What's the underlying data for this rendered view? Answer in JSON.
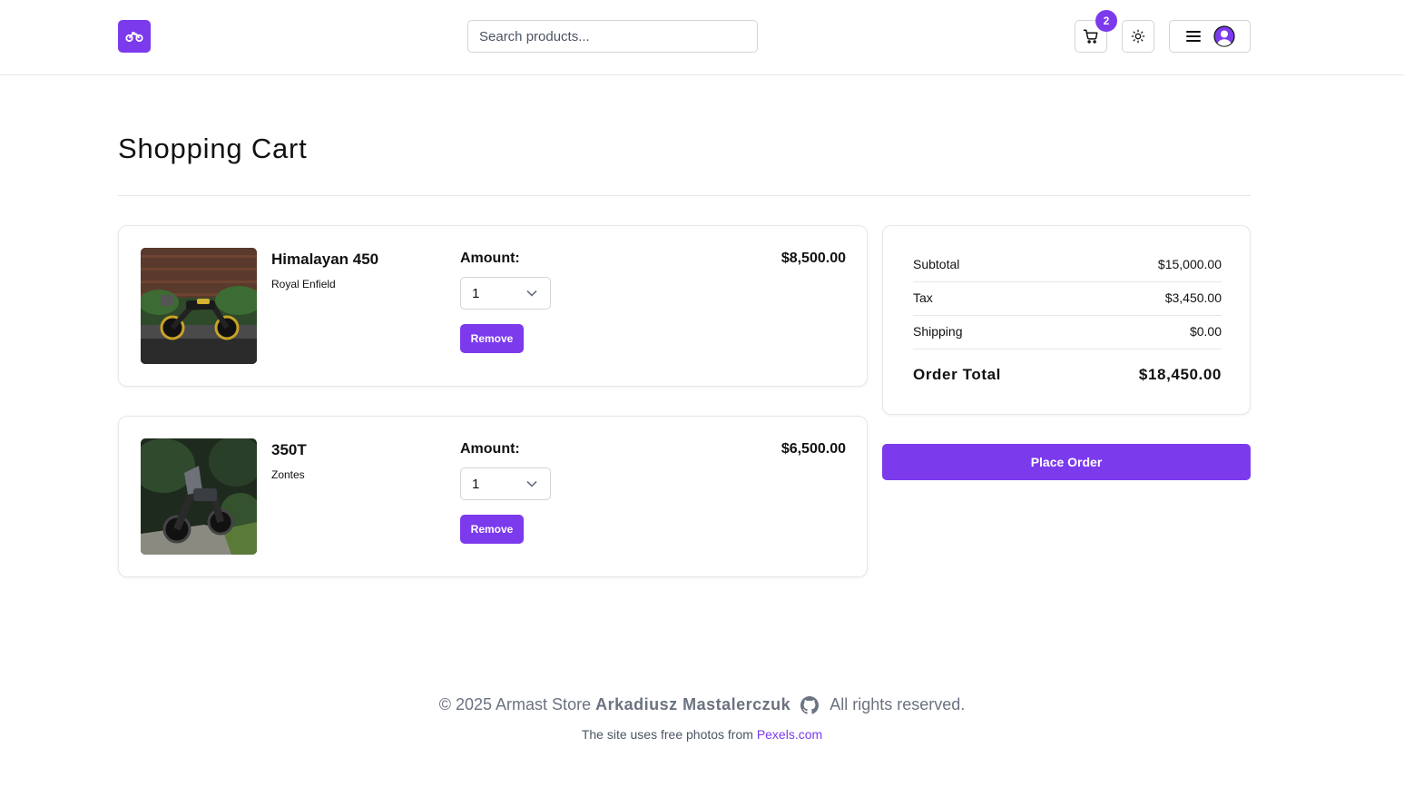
{
  "header": {
    "logo_icon": "motorcycle-icon",
    "search_placeholder": "Search products...",
    "cart_count": "2",
    "accent": "#7c3aed"
  },
  "page": {
    "title": "Shopping Cart"
  },
  "cart": {
    "items": [
      {
        "name": "Himalayan 450",
        "brand": "Royal Enfield",
        "amount_label": "Amount:",
        "quantity": "1",
        "remove_label": "Remove",
        "price": "$8,500.00"
      },
      {
        "name": "350T",
        "brand": "Zontes",
        "amount_label": "Amount:",
        "quantity": "1",
        "remove_label": "Remove",
        "price": "$6,500.00"
      }
    ]
  },
  "summary": {
    "subtotal_label": "Subtotal",
    "subtotal_value": "$15,000.00",
    "tax_label": "Tax",
    "tax_value": "$3,450.00",
    "shipping_label": "Shipping",
    "shipping_value": "$0.00",
    "total_label": "Order Total",
    "total_value": "$18,450.00",
    "place_order_label": "Place Order"
  },
  "footer": {
    "copyright": "© 2025 Armast Store",
    "author": "Arkadiusz Mastalerczuk",
    "rights": "All rights reserved.",
    "photos_text": "The site uses free photos from",
    "photos_link": "Pexels.com"
  }
}
